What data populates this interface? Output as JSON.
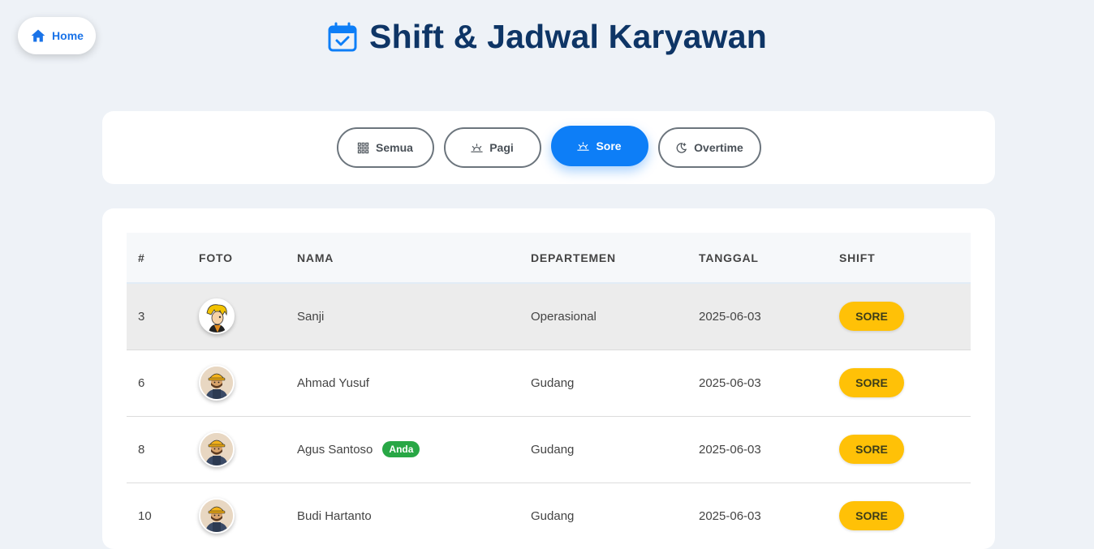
{
  "nav": {
    "home_label": "Home"
  },
  "header": {
    "title": "Shift & Jadwal Karyawan"
  },
  "filters": [
    {
      "label": "Semua",
      "icon": "grid-icon",
      "active": false
    },
    {
      "label": "Pagi",
      "icon": "sunrise-icon",
      "active": false
    },
    {
      "label": "Sore",
      "icon": "sunset-icon",
      "active": true
    },
    {
      "label": "Overtime",
      "icon": "moon-stars-icon",
      "active": false
    }
  ],
  "table": {
    "columns": [
      "#",
      "FOTO",
      "NAMA",
      "DEPARTEMEN",
      "TANGGAL",
      "SHIFT"
    ],
    "rows": [
      {
        "no": "3",
        "photo": "sanji-avatar",
        "name": "Sanji",
        "badge": "",
        "department": "Operasional",
        "date": "2025-06-03",
        "shift": "SORE"
      },
      {
        "no": "6",
        "photo": "worker-avatar",
        "name": "Ahmad Yusuf",
        "badge": "",
        "department": "Gudang",
        "date": "2025-06-03",
        "shift": "SORE"
      },
      {
        "no": "8",
        "photo": "worker-avatar",
        "name": "Agus Santoso",
        "badge": "Anda",
        "department": "Gudang",
        "date": "2025-06-03",
        "shift": "SORE"
      },
      {
        "no": "10",
        "photo": "worker-avatar",
        "name": "Budi Hartanto",
        "badge": "",
        "department": "Gudang",
        "date": "2025-06-03",
        "shift": "SORE"
      }
    ]
  },
  "colors": {
    "accent": "#0d7ef7",
    "title": "#0e3566",
    "shift_badge": "#ffc107",
    "you_badge": "#28a745",
    "background": "#eef2f7"
  }
}
